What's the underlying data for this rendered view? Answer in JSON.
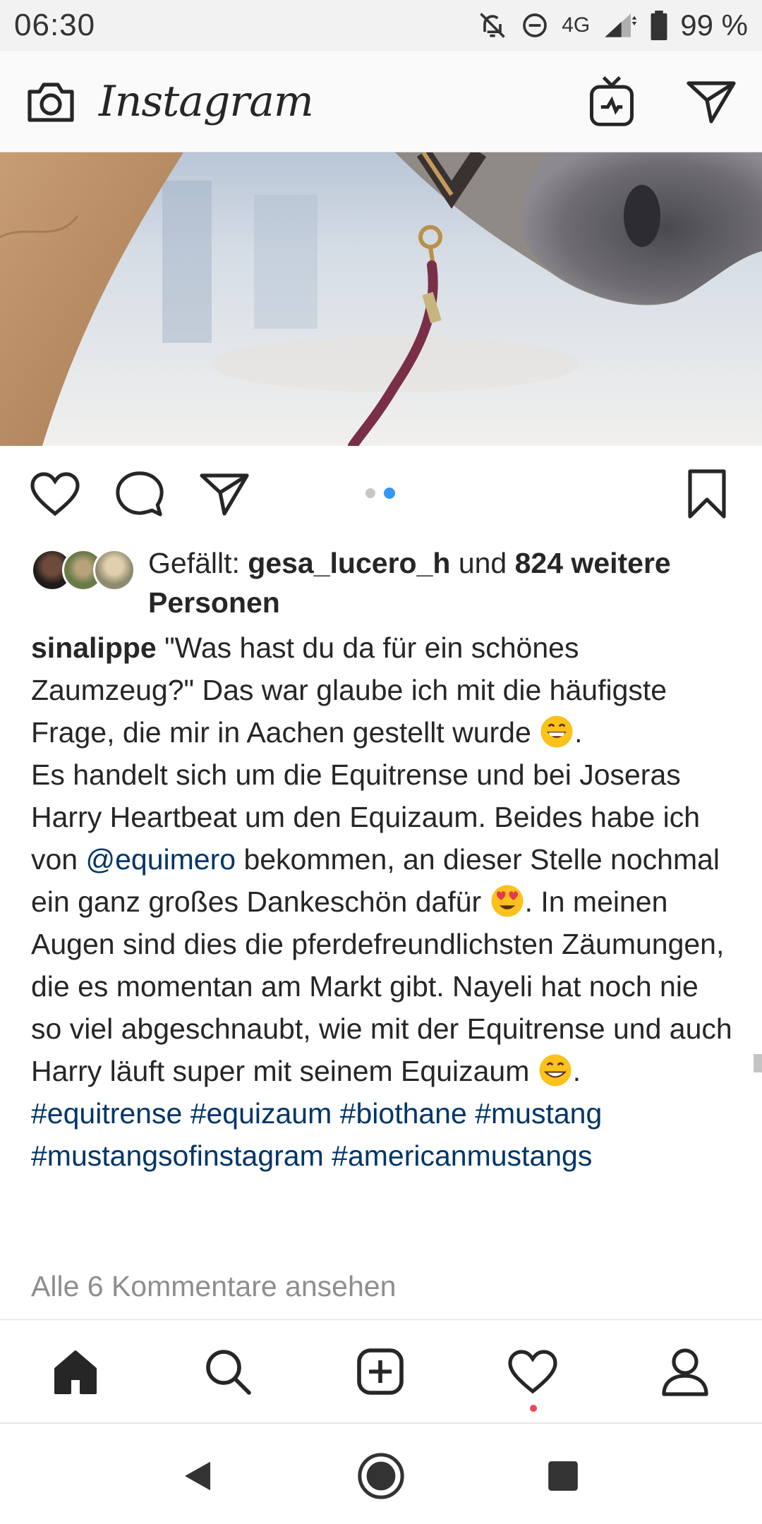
{
  "status_bar": {
    "time": "06:30",
    "network": "4G",
    "battery": "99 %"
  },
  "header": {
    "app_name": "Instagram",
    "icons": [
      "camera-icon",
      "igtv-icon",
      "direct-message-icon"
    ]
  },
  "post": {
    "image_description_icon": "horse-photo",
    "carousel": {
      "total": 2,
      "active": 2
    },
    "likes": {
      "prefix": "Gefällt: ",
      "first_user": "gesa_lucero_h",
      "connector": " und ",
      "others": "824 weitere Personen"
    },
    "caption": {
      "username": "sinalippe",
      "line1": " \"Was hast du da für ein schönes Zaumzeug?\" Das war glaube ich mit die häufigste Frage, die mir in Aachen gestellt wurde ",
      "line1_end": ".",
      "line2": "Es handelt sich um die Equitrense und bei Joseras Harry Heartbeat um den Equizaum. Beides habe ich von ",
      "mention": "@equimero",
      "line2b": " bekommen, an dieser Stelle nochmal ein ganz großes Dankeschön dafür ",
      "line2c": ". In meinen Augen sind dies die pferdefreundlichsten Zäumungen, die es momentan am Markt gibt. Nayeli hat noch nie so viel abgeschnaubt, wie mit der Equitrense und auch Harry läuft super mit seinem Equizaum ",
      "line2d": ".",
      "hashtags": [
        "#equitrense",
        "#equizaum",
        "#biothane",
        "#mustang",
        "#mustangsofinstagram",
        "#americanmustangs"
      ]
    },
    "comments_link": "Alle 6 Kommentare ansehen"
  },
  "bottom_nav": [
    "home-icon",
    "search-icon",
    "new-post-icon",
    "activity-icon",
    "profile-icon"
  ],
  "colors": {
    "link": "#003569",
    "active_dot": "#3897f0",
    "notification": "#ed4956",
    "muted": "#8e8e8e"
  }
}
